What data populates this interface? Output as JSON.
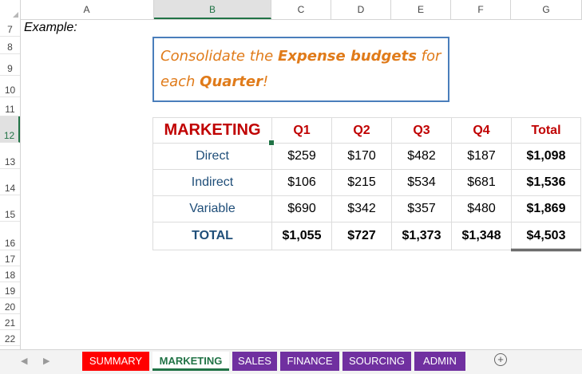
{
  "column_headers": [
    "A",
    "B",
    "C",
    "D",
    "E",
    "F",
    "G"
  ],
  "row_headers": [
    "7",
    "8",
    "9",
    "10",
    "11",
    "12",
    "13",
    "14",
    "15",
    "16",
    "17",
    "18",
    "19",
    "20",
    "21",
    "22"
  ],
  "example_label": "Example:",
  "note": {
    "part1": "Consolidate the ",
    "bold1": "Expense budgets",
    "part2": " for each ",
    "bold2": "Quarter",
    "part3": "!"
  },
  "table": {
    "title": "MARKETING",
    "headers": [
      "Q1",
      "Q2",
      "Q3",
      "Q4",
      "Total"
    ],
    "rows": [
      {
        "label": "Direct",
        "values": [
          "$259",
          "$170",
          "$482",
          "$187"
        ],
        "total": "$1,098"
      },
      {
        "label": "Indirect",
        "values": [
          "$106",
          "$215",
          "$534",
          "$681"
        ],
        "total": "$1,536"
      },
      {
        "label": "Variable",
        "values": [
          "$690",
          "$342",
          "$357",
          "$480"
        ],
        "total": "$1,869"
      }
    ],
    "total_row": {
      "label": "TOTAL",
      "values": [
        "$1,055",
        "$727",
        "$1,373",
        "$1,348"
      ],
      "total": "$4,503"
    }
  },
  "sheet_tabs": [
    "SUMMARY",
    "MARKETING",
    "SALES",
    "FINANCE",
    "SOURCING",
    "ADMIN"
  ],
  "active_tab": "MARKETING",
  "add_sheet_symbol": "+",
  "colors": {
    "accent_green": "#217346",
    "header_red": "#c00000",
    "label_blue": "#1f4e79",
    "note_orange": "#e07b1a",
    "note_border": "#4a7ebb",
    "tab_red": "#ff0000",
    "tab_purple": "#7030a0"
  }
}
